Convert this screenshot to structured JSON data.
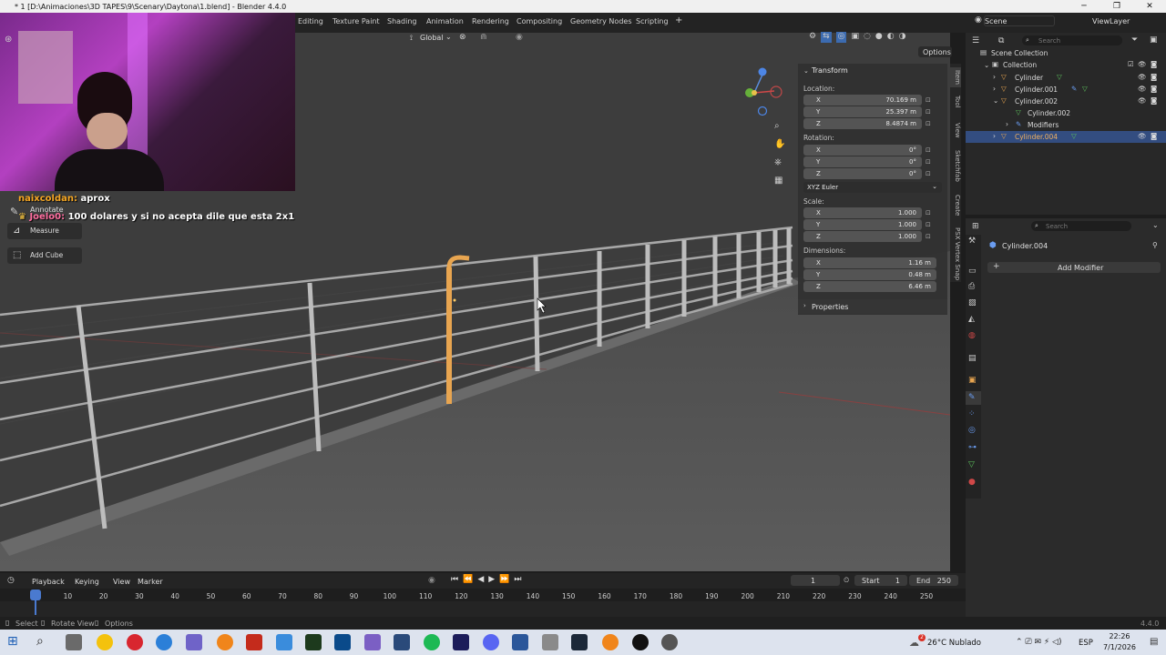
{
  "window": {
    "title": "* 1 [D:\\Animaciones\\3D TAPES\\9\\Scenary\\Daytona\\1.blend] - Blender 4.4.0",
    "minimize": "─",
    "maximize": "❐",
    "close": "✕"
  },
  "workspace_tabs": [
    "Editing",
    "Texture Paint",
    "Shading",
    "Animation",
    "Rendering",
    "Compositing",
    "Geometry Nodes",
    "Scripting",
    "+"
  ],
  "scene": {
    "label": "Scene",
    "view_layer": "ViewLayer"
  },
  "viewport": {
    "orientation": "Global",
    "options_label": "Options"
  },
  "chat": [
    {
      "user": "naixcoldan:",
      "message": "aprox",
      "user_color": "#f5a623"
    },
    {
      "user": "Joelo0:",
      "message": "100 dolares y si no acepta dile que esta 2x1",
      "user_color": "#ff6fa0"
    }
  ],
  "tools": {
    "annotate": "Annotate",
    "measure": "Measure",
    "add_cube": "Add Cube"
  },
  "npanel": {
    "transform_header": "Transform",
    "location_label": "Location:",
    "location": {
      "x": "70.169 m",
      "y": "25.397 m",
      "z": "8.4874 m"
    },
    "rotation_label": "Rotation:",
    "rotation": {
      "x": "0°",
      "y": "0°",
      "z": "0°"
    },
    "rotation_mode": "XYZ Euler",
    "scale_label": "Scale:",
    "scale": {
      "x": "1.000",
      "y": "1.000",
      "z": "1.000"
    },
    "dimensions_label": "Dimensions:",
    "dimensions": {
      "x": "1.16 m",
      "y": "0.48 m",
      "z": "6.46 m"
    },
    "properties_header": "Properties",
    "axis": {
      "x": "X",
      "y": "Y",
      "z": "Z"
    }
  },
  "side_tabs": [
    "Item",
    "Tool",
    "View",
    "Sketchfab",
    "Create",
    "PSX Vertex Snap"
  ],
  "outliner": {
    "search_placeholder": "Search",
    "scene_collection": "Scene Collection",
    "collection": "Collection",
    "items": [
      "Cylinder",
      "Cylinder.001",
      "Cylinder.002",
      "Cylinder.002",
      "Modifiers",
      "Cylinder.004"
    ]
  },
  "properties": {
    "search_placeholder": "Search",
    "object_name": "Cylinder.004",
    "add_modifier": "Add Modifier"
  },
  "timeline": {
    "menus": [
      "Playback",
      "Keying",
      "View",
      "Marker"
    ],
    "current_frame": "1",
    "start_label": "Start",
    "start": "1",
    "end_label": "End",
    "end": "250",
    "ticks": [
      "1",
      "10",
      "20",
      "30",
      "40",
      "50",
      "60",
      "70",
      "80",
      "90",
      "100",
      "110",
      "120",
      "130",
      "140",
      "150",
      "160",
      "170",
      "180",
      "190",
      "200",
      "210",
      "220",
      "230",
      "240",
      "250"
    ]
  },
  "status": {
    "select": "Select",
    "rotate_view": "Rotate View",
    "options": "Options",
    "version": "4.4.0"
  },
  "taskbar": {
    "weather": "26°C  Nublado",
    "language": "ESP",
    "time": "22:26",
    "date": "7/1/2026",
    "notif_badge": "2"
  }
}
